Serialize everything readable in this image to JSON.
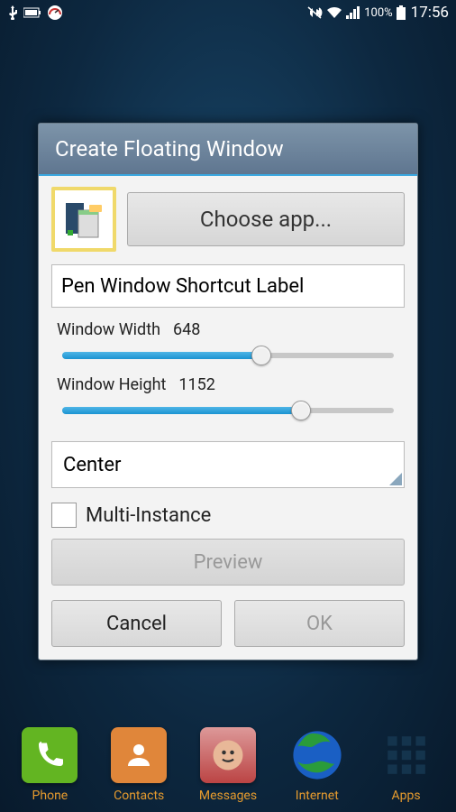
{
  "status": {
    "battery_pct": "100%",
    "time": "17:56"
  },
  "dialog": {
    "title": "Create Floating Window",
    "choose_app": "Choose app...",
    "label_input": "Pen Window Shortcut Label",
    "width_label": "Window Width",
    "width_value": "648",
    "width_pct": 60,
    "height_label": "Window Height",
    "height_value": "1152",
    "height_pct": 72,
    "position": "Center",
    "multi_instance": "Multi-Instance",
    "preview": "Preview",
    "cancel": "Cancel",
    "ok": "OK"
  },
  "dock": {
    "items": [
      {
        "label": "Phone",
        "bg": "#63b522"
      },
      {
        "label": "Contacts",
        "bg": "#e0863a"
      },
      {
        "label": "Messages",
        "bg": "#b44"
      },
      {
        "label": "Internet",
        "bg": "#1a4fae"
      },
      {
        "label": "Apps",
        "bg": "transparent"
      }
    ]
  }
}
